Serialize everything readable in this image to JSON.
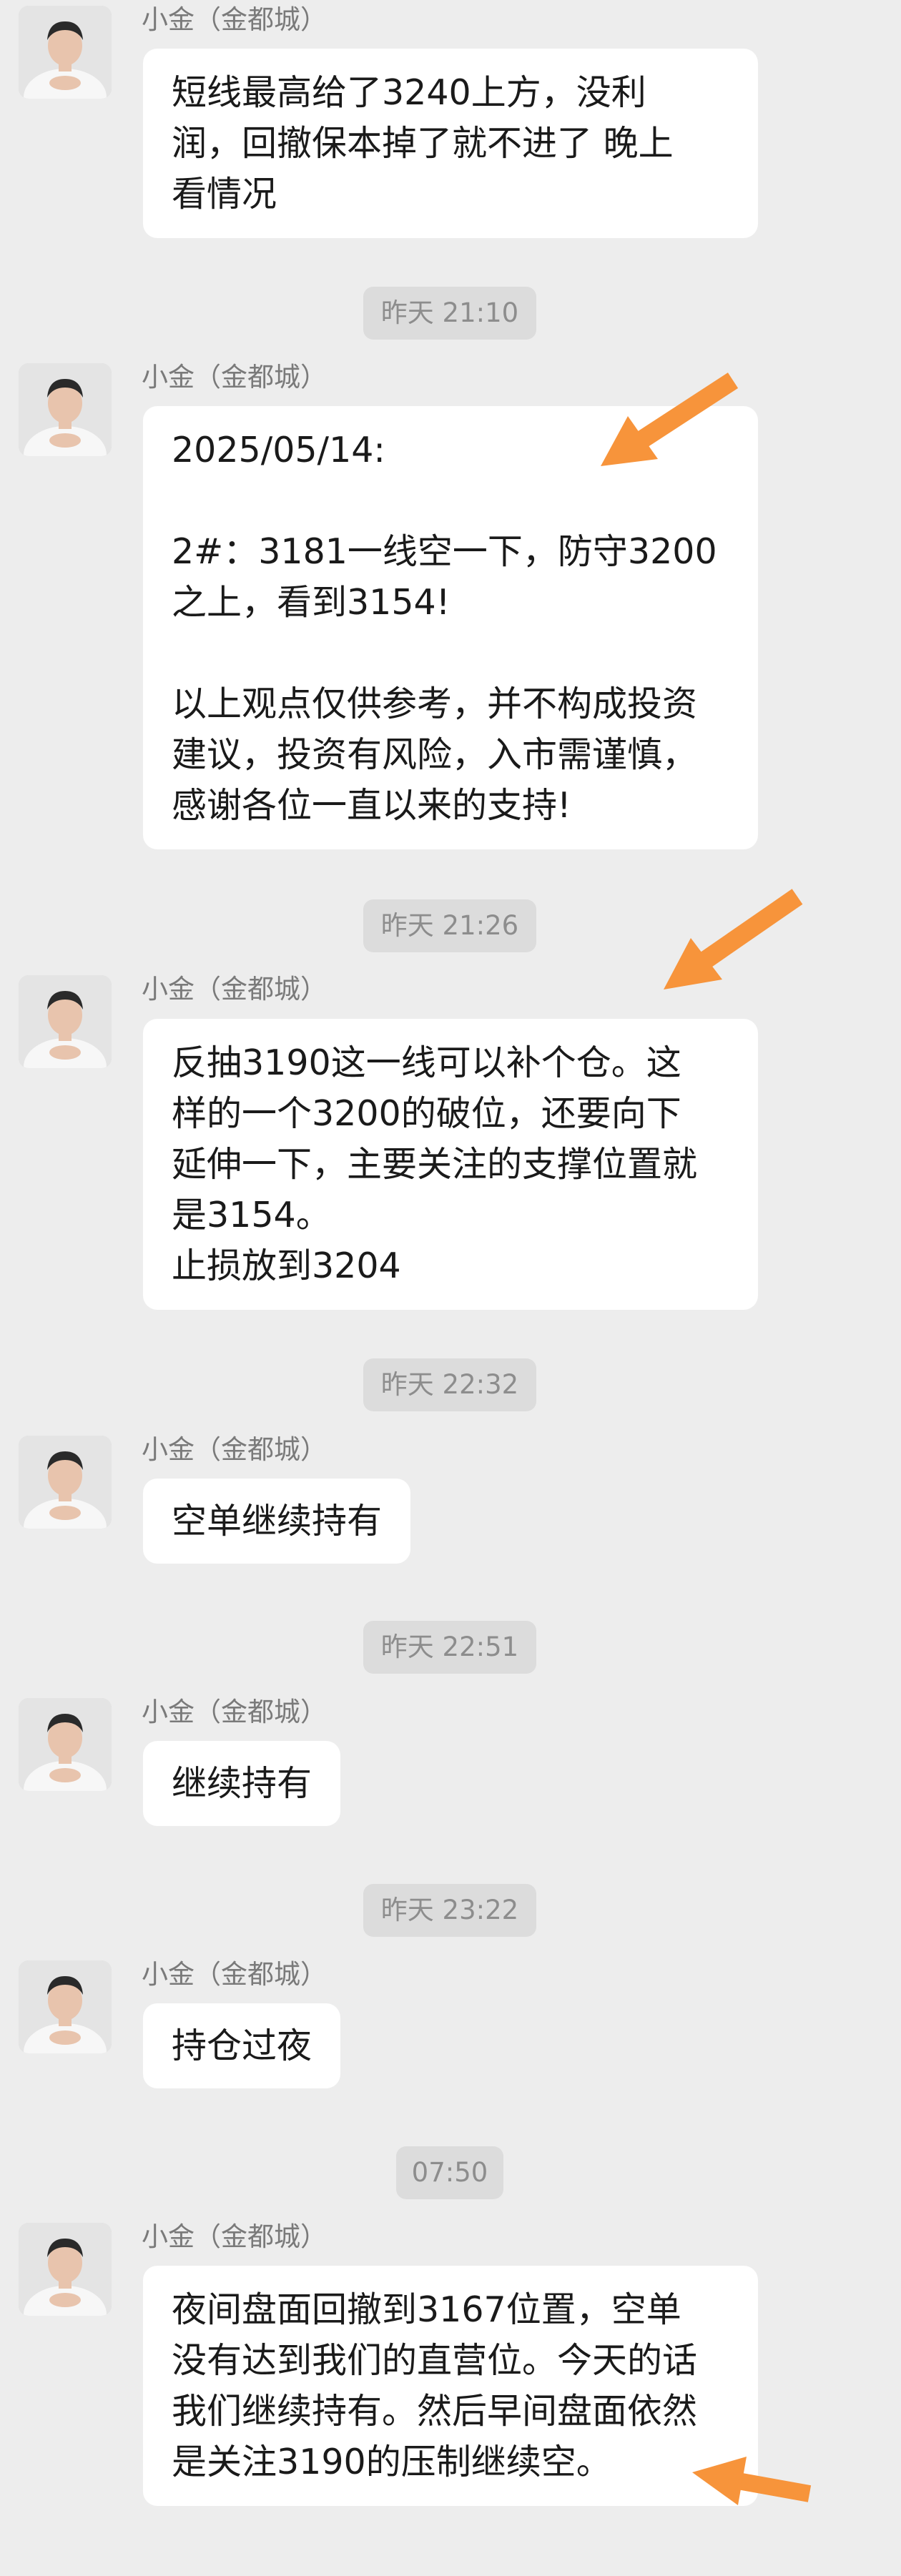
{
  "chat": {
    "sender_name": "小金（金都城）",
    "avatar_icon": "person-avatar-icon",
    "messages": [
      {
        "lines": [
          "短线最高给了3240上方，没利",
          "润，回撤保本掉了就不进了 晚上",
          "看情况"
        ]
      },
      {
        "lines": [
          "2025/05/14:",
          "",
          "2#：3181一线空一下，防守3200",
          "之上，看到3154!",
          "",
          "以上观点仅供参考，并不构成投资",
          "建议，投资有风险，入市需谨慎，",
          "感谢各位一直以来的支持!"
        ]
      },
      {
        "lines": [
          "反抽3190这一线可以补个仓。这",
          "样的一个3200的破位，还要向下",
          "延伸一下，主要关注的支撑位置就",
          "是3154。",
          "止损放到3204"
        ]
      },
      {
        "lines": [
          "空单继续持有"
        ]
      },
      {
        "lines": [
          "继续持有"
        ]
      },
      {
        "lines": [
          "持仓过夜"
        ]
      },
      {
        "lines": [
          "夜间盘面回撤到3167位置，空单",
          "没有达到我们的直营位。今天的话",
          "我们继续持有。然后早间盘面依然",
          "是关注3190的压制继续空。"
        ]
      }
    ],
    "timestamps": [
      "昨天 21:10",
      "昨天 21:26",
      "昨天 22:32",
      "昨天 22:51",
      "昨天 23:22",
      "07:50"
    ]
  },
  "annotations": {
    "arrow_color": "#f7943b",
    "arrow_icon": "orange-arrow-icon"
  }
}
